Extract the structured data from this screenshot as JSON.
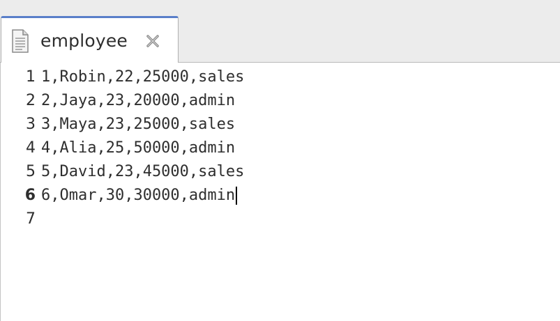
{
  "tab": {
    "label": "employee",
    "file_icon": "text-file-icon",
    "close_icon": "close-icon"
  },
  "editor": {
    "current_line": 6,
    "line_numbers": [
      "1",
      "2",
      "3",
      "4",
      "5",
      "6",
      "7"
    ],
    "lines": [
      "1,Robin,22,25000,sales",
      "2,Jaya,23,20000,admin",
      "3,Maya,23,25000,sales",
      "4,Alia,25,50000,admin",
      "5,David,23,45000,sales",
      "6,Omar,30,30000,admin",
      ""
    ]
  }
}
